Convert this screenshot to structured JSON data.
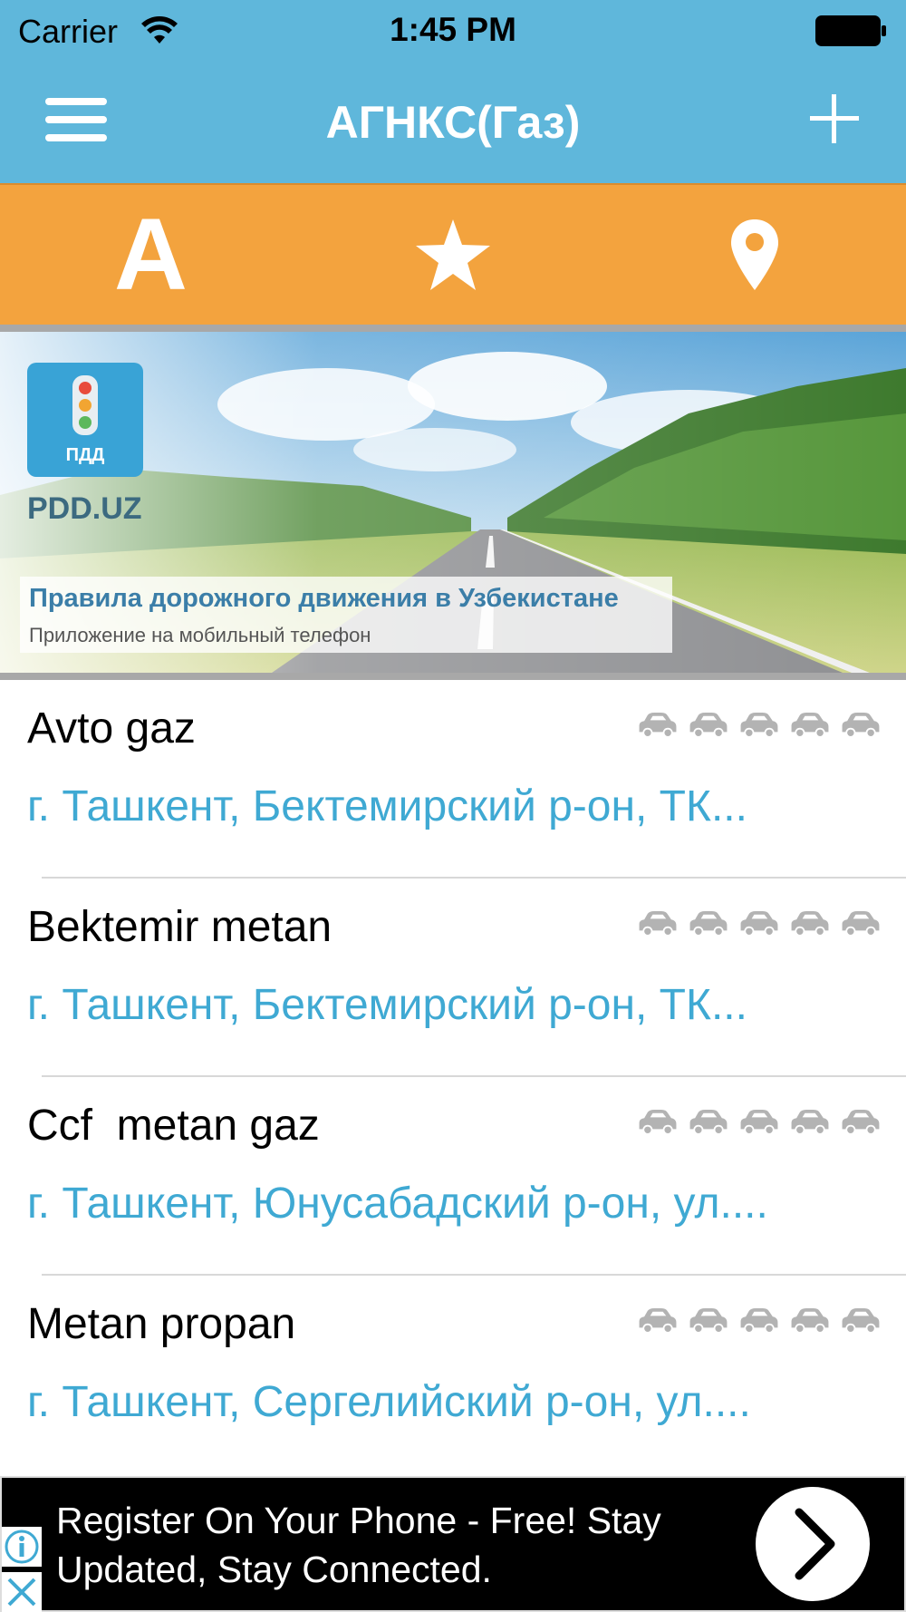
{
  "status_bar": {
    "carrier": "Carrier",
    "time": "1:45 PM",
    "wifi_icon": "wifi-icon",
    "battery_icon": "battery-full-icon"
  },
  "nav": {
    "title": "АГНКС(Газ)",
    "menu_icon": "hamburger-menu-icon",
    "add_icon": "plus-icon"
  },
  "filters": {
    "alphabetical_label": "A",
    "favorites_icon": "star-icon",
    "location_icon": "map-pin-icon"
  },
  "banner": {
    "logo_text": "ПДД",
    "brand": "PDD.UZ",
    "title": "Правила дорожного движения в Узбекистане",
    "subtitle": "Приложение на мобильный телефон"
  },
  "stations": [
    {
      "name": "Avto gaz",
      "address": "г. Ташкент, Бектемирский р-он, ТК...",
      "rating": 0,
      "rating_max": 5
    },
    {
      "name": "Bektemir metan",
      "address": "г. Ташкент, Бектемирский р-он, ТК...",
      "rating": 0,
      "rating_max": 5
    },
    {
      "name": "Ccf  metan gaz",
      "address": "г. Ташкент, Юнусабадский р-он, ул....",
      "rating": 0,
      "rating_max": 5
    },
    {
      "name": "Metan propan",
      "address": "г. Ташкент, Сергелийский р-он, ул....",
      "rating": 0,
      "rating_max": 5
    }
  ],
  "ad": {
    "text": "Register On Your Phone - Free! Stay Updated, Stay Connected.",
    "info_icon": "info-icon",
    "close_icon": "close-icon",
    "cta_icon": "chevron-right-icon"
  },
  "colors": {
    "nav_blue": "#5fb7db",
    "filter_orange": "#f3a33e",
    "address_blue": "#3fa9d3",
    "rating_gray": "#b3b3b3"
  }
}
